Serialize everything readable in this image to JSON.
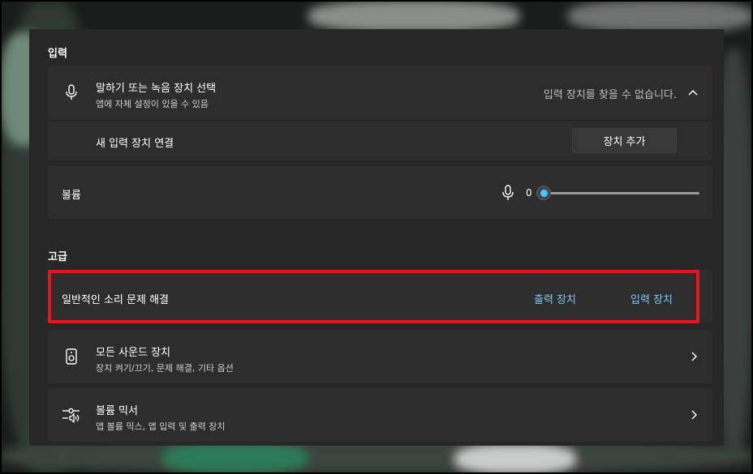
{
  "input_section": {
    "title": "입력",
    "device_select": {
      "title": "말하기 또는 녹음 장치 선택",
      "subtitle": "앱에 자체 설정이 있을 수 있음",
      "status": "입력 장치를 찾을 수 없습니다.",
      "icon": "microphone-icon",
      "expand_icon": "chevron-up-icon"
    },
    "new_device": {
      "title": "새 입력 장치 연결",
      "button_label": "장치 추가"
    },
    "volume": {
      "label": "볼륨",
      "value": "0",
      "level": 0,
      "icon": "microphone-icon"
    }
  },
  "advanced_section": {
    "title": "고급",
    "troubleshoot": {
      "title": "일반적인 소리 문제 해결",
      "output_link": "출력 장치",
      "input_link": "입력 장치"
    },
    "all_devices": {
      "title": "모든 사운드 장치",
      "subtitle": "장치 켜기/끄기, 문제 해결, 기타 옵션",
      "icon": "speaker-icon"
    },
    "volume_mixer": {
      "title": "볼륨 믹서",
      "subtitle": "앱 볼륨 믹스, 앱 입력 및 출력 장치",
      "icon": "mixer-icon"
    }
  },
  "colors": {
    "accent": "#4cc2ff",
    "link": "#7cc8f2",
    "highlight_border": "#e4151d",
    "panel": "#272727",
    "card": "#2d2d2d"
  }
}
